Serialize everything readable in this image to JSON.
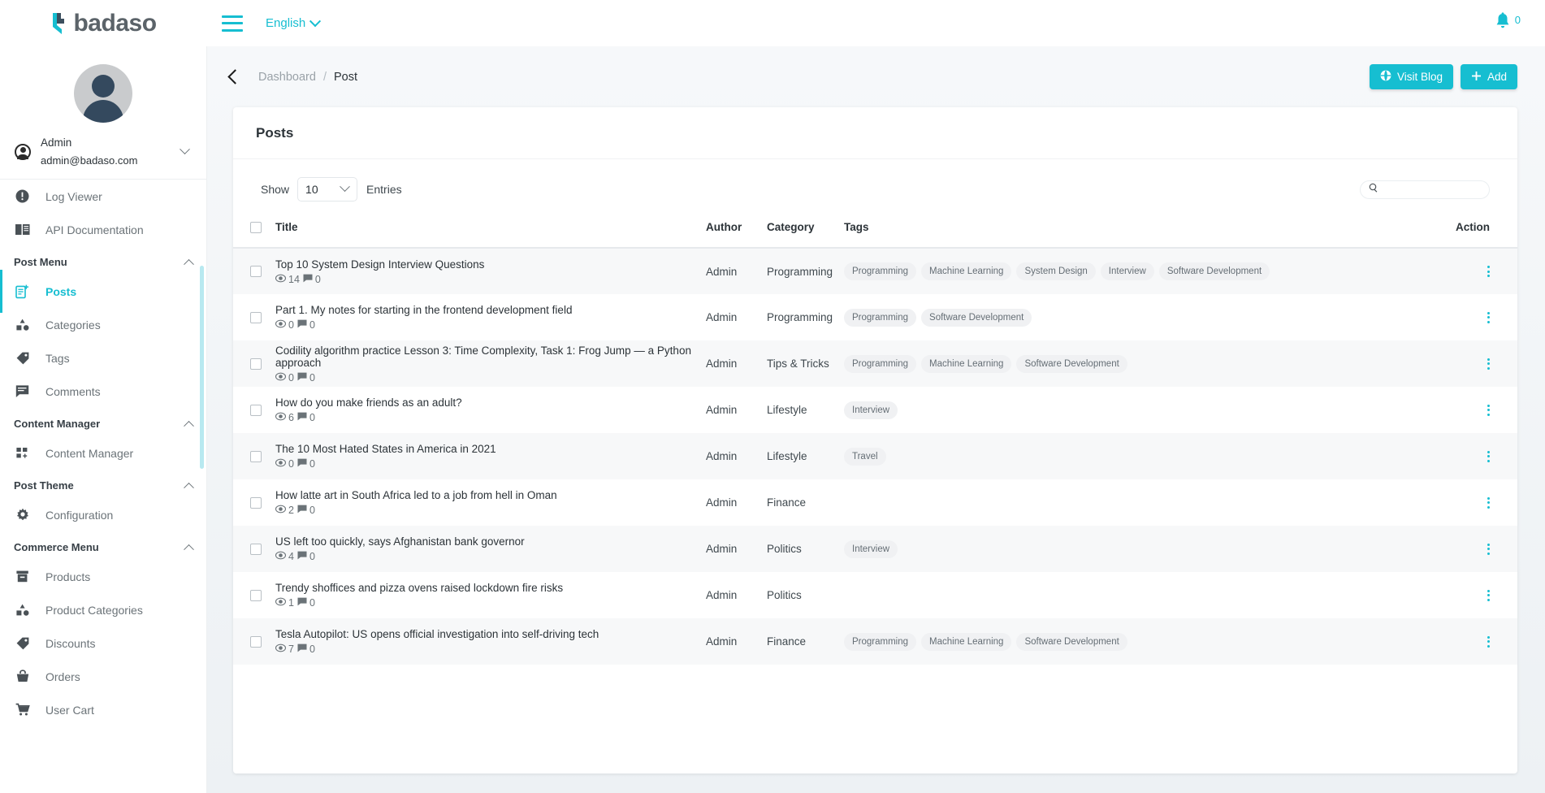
{
  "topbar": {
    "brand": "badaso",
    "language": "English",
    "notification_count": "0"
  },
  "sidebar": {
    "user": {
      "name": "Admin",
      "email": "admin@badaso.com"
    },
    "items": [
      {
        "type": "item",
        "label": "Log Viewer",
        "icon": "alert-circle-icon",
        "active": false
      },
      {
        "type": "item",
        "label": "API Documentation",
        "icon": "book-icon",
        "active": false
      },
      {
        "type": "group",
        "label": "Post Menu"
      },
      {
        "type": "item",
        "label": "Posts",
        "icon": "post-add-icon",
        "active": true
      },
      {
        "type": "item",
        "label": "Categories",
        "icon": "shapes-icon",
        "active": false
      },
      {
        "type": "item",
        "label": "Tags",
        "icon": "tag-icon",
        "active": false
      },
      {
        "type": "item",
        "label": "Comments",
        "icon": "comment-icon",
        "active": false
      },
      {
        "type": "group",
        "label": "Content Manager"
      },
      {
        "type": "item",
        "label": "Content Manager",
        "icon": "grid-add-icon",
        "active": false
      },
      {
        "type": "group",
        "label": "Post Theme"
      },
      {
        "type": "item",
        "label": "Configuration",
        "icon": "gear-icon",
        "active": false
      },
      {
        "type": "group",
        "label": "Commerce Menu"
      },
      {
        "type": "item",
        "label": "Products",
        "icon": "box-icon",
        "active": false
      },
      {
        "type": "item",
        "label": "Product Categories",
        "icon": "shapes-icon",
        "active": false
      },
      {
        "type": "item",
        "label": "Discounts",
        "icon": "tag-icon",
        "active": false
      },
      {
        "type": "item",
        "label": "Orders",
        "icon": "basket-icon",
        "active": false
      },
      {
        "type": "item",
        "label": "User Cart",
        "icon": "cart-icon",
        "active": false
      }
    ]
  },
  "breadcrumb": {
    "parent": "Dashboard",
    "separator": "/",
    "current": "Post",
    "visit_blog_label": "Visit Blog",
    "add_label": "Add"
  },
  "card": {
    "title": "Posts",
    "show_label": "Show",
    "entries_label": "Entries",
    "page_size": "10",
    "search_placeholder": ""
  },
  "table": {
    "columns": [
      "Title",
      "Author",
      "Category",
      "Tags",
      "Action"
    ],
    "rows": [
      {
        "title": "Top 10 System Design Interview Questions",
        "views": "14",
        "comments": "0",
        "author": "Admin",
        "category": "Programming",
        "tags": [
          "Programming",
          "Machine Learning",
          "System Design",
          "Interview",
          "Software Development"
        ]
      },
      {
        "title": "Part 1. My notes for starting in the frontend development field",
        "views": "0",
        "comments": "0",
        "author": "Admin",
        "category": "Programming",
        "tags": [
          "Programming",
          "Software Development"
        ]
      },
      {
        "title": "Codility algorithm practice Lesson 3: Time Complexity, Task 1: Frog Jump — a Python approach",
        "views": "0",
        "comments": "0",
        "author": "Admin",
        "category": "Tips & Tricks",
        "tags": [
          "Programming",
          "Machine Learning",
          "Software Development"
        ]
      },
      {
        "title": "How do you make friends as an adult?",
        "views": "6",
        "comments": "0",
        "author": "Admin",
        "category": "Lifestyle",
        "tags": [
          "Interview"
        ]
      },
      {
        "title": "The 10 Most Hated States in America in 2021",
        "views": "0",
        "comments": "0",
        "author": "Admin",
        "category": "Lifestyle",
        "tags": [
          "Travel"
        ]
      },
      {
        "title": "How latte art in South Africa led to a job from hell in Oman",
        "views": "2",
        "comments": "0",
        "author": "Admin",
        "category": "Finance",
        "tags": []
      },
      {
        "title": "US left too quickly, says Afghanistan bank governor",
        "views": "4",
        "comments": "0",
        "author": "Admin",
        "category": "Politics",
        "tags": [
          "Interview"
        ]
      },
      {
        "title": "Trendy shoffices and pizza ovens raised lockdown fire risks",
        "views": "1",
        "comments": "0",
        "author": "Admin",
        "category": "Politics",
        "tags": []
      },
      {
        "title": "Tesla Autopilot: US opens official investigation into self-driving tech",
        "views": "7",
        "comments": "0",
        "author": "Admin",
        "category": "Finance",
        "tags": [
          "Programming",
          "Machine Learning",
          "Software Development"
        ]
      }
    ]
  },
  "colors": {
    "accent": "#16bed1",
    "text": "#2c3338",
    "muted": "#6b7378"
  }
}
